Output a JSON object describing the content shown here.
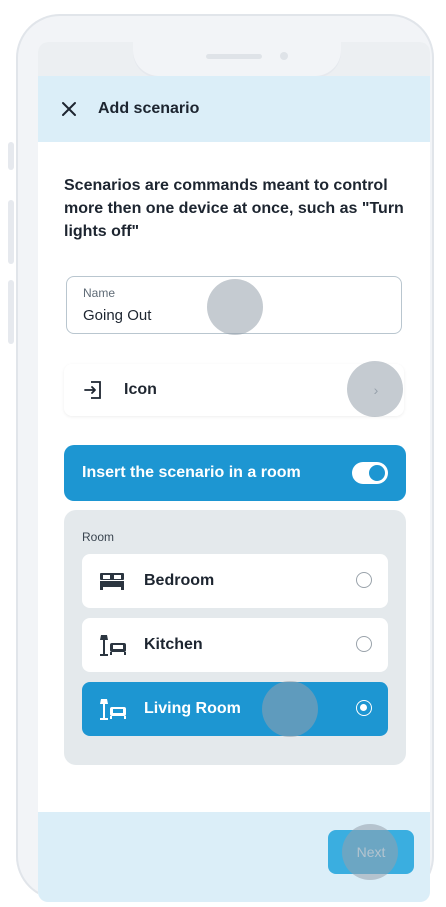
{
  "header": {
    "close_icon": "close-icon",
    "title": "Add scenario"
  },
  "description": "Scenarios are commands meant to control more then one device at once, such as \"Turn lights off\"",
  "name_field": {
    "label": "Name",
    "value": "Going Out"
  },
  "icon_row": {
    "icon": "sign-in-icon",
    "label": "Icon",
    "chevron": "›"
  },
  "room_toggle": {
    "label": "Insert the scenario in a room",
    "enabled": true
  },
  "room_panel": {
    "label": "Room",
    "rooms": [
      {
        "label": "Bedroom",
        "icon": "bed-icon",
        "selected": false
      },
      {
        "label": "Kitchen",
        "icon": "lamp-armchair-icon",
        "selected": false
      },
      {
        "label": "Living Room",
        "icon": "lamp-armchair-icon",
        "selected": true
      }
    ]
  },
  "footer": {
    "next_label": "Next"
  },
  "colors": {
    "accent": "#1d96d2",
    "header_bg": "#dbeef8",
    "panel_bg": "#e4e9ec"
  }
}
